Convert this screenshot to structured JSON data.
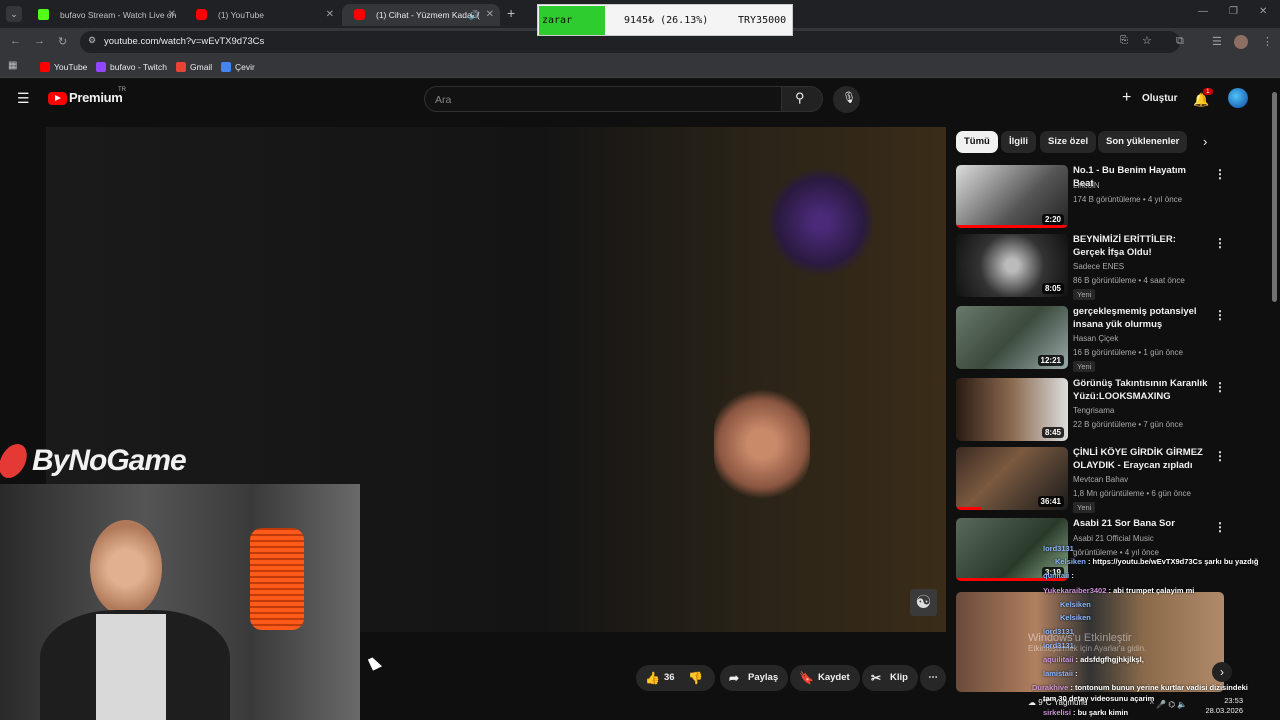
{
  "browser": {
    "tabs": [
      {
        "title": "bufavo Stream - Watch Live on"
      },
      {
        "title": "(1) YouTube"
      },
      {
        "title": "(1) Cihat - Yüzmem Kadar ("
      }
    ],
    "url": "youtube.com/watch?v=wEvTX9d73Cs",
    "bookmarks": [
      "YouTube",
      "bufavo - Twitch",
      "Gmail",
      "Çevir"
    ]
  },
  "stock_widget": {
    "label": "zarar",
    "value": "9145₺ (26.13%)",
    "symbol": "TRY35000"
  },
  "youtube": {
    "logo": "Premium",
    "logo_sup": "TR",
    "search_placeholder": "Ara",
    "create_label": "Oluştur",
    "notif_count": "1",
    "chips": [
      "Tümü",
      "İlgili",
      "Size özel",
      "Son yüklenenler"
    ],
    "recommendations": [
      {
        "title": "No.1 - Bu Benim Hayatım Beat",
        "channel": "LincolN",
        "meta": "174 B görüntüleme • 4 yıl önce",
        "duration": "2:20",
        "new": ""
      },
      {
        "title": "BEYNİMİZİ ERİTTİLER: Gerçek İfşa Oldu!",
        "channel": "Sadece ENES",
        "meta": "86 B görüntüleme • 4 saat önce",
        "duration": "8:05",
        "new": "Yeni"
      },
      {
        "title": "gerçekleşmemiş potansiyel insana yük olurmuş",
        "channel": "Hasan Çiçek",
        "meta": "16 B görüntüleme • 1 gün önce",
        "duration": "12:21",
        "new": "Yeni"
      },
      {
        "title": "Görünüş Takıntısının Karanlık Yüzü:LOOKSMAXING",
        "channel": "Tengrisama",
        "meta": "22 B görüntüleme • 7 gün önce",
        "duration": "8:45",
        "new": ""
      },
      {
        "title": "ÇİNLİ KÖYE GİRDİK GİRMEZ OLAYDIK - Eraycan zıpladı",
        "channel": "Mevtcan Bahav",
        "meta": "1,8 Mn görüntüleme • 6 gün önce",
        "duration": "36:41",
        "new": "Yeni"
      },
      {
        "title": "Asabi 21 Sor Bana Sor",
        "channel": "Asabi 21 Official Music",
        "meta": "görüntüleme • 4 yıl önce",
        "duration": "3:19",
        "new": ""
      }
    ],
    "actions": {
      "likes": "36",
      "share": "Paylaş",
      "save": "Kaydet",
      "clip": "Klip"
    },
    "thumb6_overlay": "Paylaş"
  },
  "stream_overlay": {
    "brand": "ByNoGame",
    "chat": [
      {
        "user": "lord3131",
        "text": ""
      },
      {
        "user": "Kelsiken",
        "text": "https://youtu.be/wEvTX9d73Cs şarkı bu yazdığ"
      },
      {
        "user": "quilitaii",
        "text": ""
      },
      {
        "user": "Yukekaraiber3402",
        "text": "abi trumpet çalayim mi"
      },
      {
        "user": "Kelsiken",
        "text": ""
      },
      {
        "user": "Kelsiken",
        "text": ""
      },
      {
        "user": "lord3131",
        "text": ""
      },
      {
        "user": "lord3131",
        "text": ""
      },
      {
        "user": "aquilitaii",
        "text": "adsfdgfhgjhkjlkşl,"
      },
      {
        "user": "lamistaii",
        "text": ""
      },
      {
        "user": "Durakhive",
        "text": "tontonum bunun yerine kurtlar vadisi dizisindeki"
      },
      {
        "user": "",
        "text": "tam 30 detay videosunu açarim"
      },
      {
        "user": "sirkelisi",
        "text": "bu şarkı kimin"
      }
    ],
    "windows_watermark": "Windows'u Etkinleştir",
    "windows_sub": "Etkinleştirmek için Ayarlar'a gidin."
  },
  "taskbar": {
    "weather": "9°C",
    "weather_desc": "Yağmurlu",
    "time": "23:53",
    "date": "28.03.2026"
  },
  "colors": {
    "yt_red": "#ff0000",
    "stock_green": "#2ecc2e",
    "bg": "#0f0f0f"
  }
}
